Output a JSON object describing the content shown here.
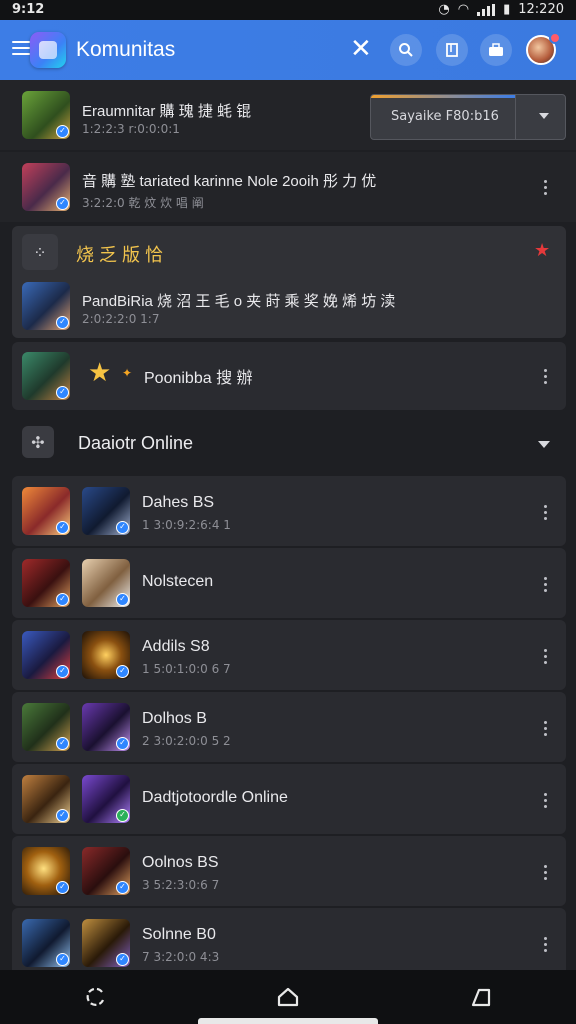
{
  "status": {
    "time_left": "9:12",
    "time_right": "12:220"
  },
  "appbar": {
    "title": "Komunitas",
    "icons": [
      "menu-icon",
      "app-logo",
      "close-icon",
      "search-icon",
      "bookmark-icon",
      "briefcase-icon",
      "avatar"
    ],
    "accent": "#3d7de6"
  },
  "top_rows": [
    {
      "title": "Eraumnitar 購 瑰 捷 蚝 锟",
      "subtitle": "1:2:2:3 r:0:0:0:1",
      "dropdown": "Sayaike F80:b16"
    },
    {
      "title": "音 購 塾 tariated karinne Nole 2ooih 彤 力 优",
      "subtitle": "3:2:2:0 乾 炆 炊 唱 阐"
    }
  ],
  "favorites": {
    "title": "烧 乏 版 恰",
    "row_title": "PandBiRia 烧 沼 王 毛 o 夹 莳 乘 奖  娩 烯 坊 渎",
    "row_subtitle": "2:0:2:2:0 1:7",
    "star_color": "#e5393b"
  },
  "single_row": {
    "title": "Poonibba 搜 辦"
  },
  "online_section": {
    "title": "Daaiotr Online",
    "rows": [
      {
        "title": "Dahes BS",
        "subtitle": "1 3:0:9:2:6:4 1"
      },
      {
        "title": "Nolstecen",
        "subtitle": ""
      },
      {
        "title": "Addils S8",
        "subtitle": "1 5:0:1:0:0 6 7"
      },
      {
        "title": "Dolhos B",
        "subtitle": "2 3:0:2:0:0 5 2"
      },
      {
        "title": "Dadtjotoordle Online",
        "subtitle": ""
      },
      {
        "title": "Oolnos BS",
        "subtitle": "3 5:2:3:0:6 7"
      },
      {
        "title": "Solnne B0",
        "subtitle": "7 3:2:0:0 4:3"
      }
    ]
  },
  "navbar": {
    "icons": [
      "recents-icon",
      "home-icon",
      "back-icon"
    ]
  }
}
